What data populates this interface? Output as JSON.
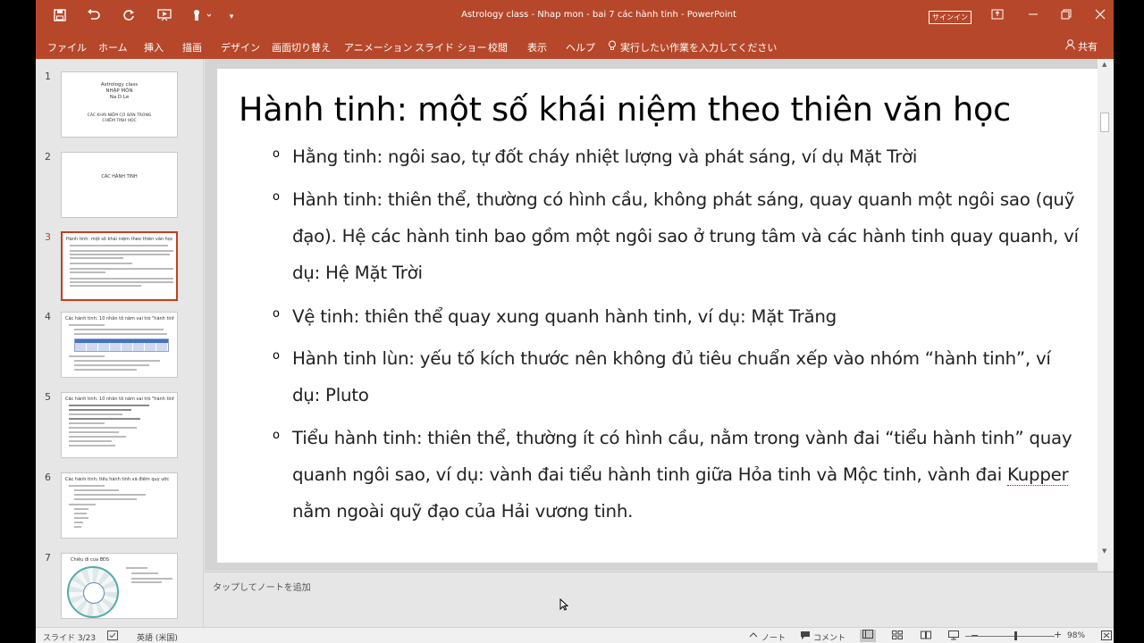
{
  "window": {
    "title": "Astrology class - Nhap mon - bai 7 các hành tinh  -  PowerPoint",
    "signin": "サインイン"
  },
  "quick_access": {
    "save_icon": "save-icon",
    "undo_icon": "undo-icon",
    "redo_icon": "redo-icon"
  },
  "ribbon": {
    "tabs": [
      "ファイル",
      "ホーム",
      "挿入",
      "描画",
      "デザイン",
      "画面切り替え",
      "アニメーション",
      "スライド ショー",
      "校閲",
      "表示",
      "ヘルプ"
    ],
    "tell_me": "実行したい作業を入力してください",
    "share": "共有"
  },
  "thumbnails": {
    "numbers": [
      "1",
      "2",
      "3",
      "4",
      "5",
      "6",
      "7"
    ],
    "slide1": {
      "line1": "Astrology class",
      "line2": "NHẬP MÔN",
      "line3": "Na D Le",
      "line4": "CÁC KHÁI NIỆM CƠ BẢN TRONG",
      "line5": "CHIÊM TINH HỌC"
    },
    "slide2": {
      "title": "CÁC HÀNH TINH"
    },
    "slide3": {
      "title": "Hành tinh: một số khái niệm theo thiên văn học"
    },
    "slide4": {
      "title": "Các hành tinh: 10 nhân tố nằm vai trò \"hành tinh\""
    },
    "slide5": {
      "title": "Các hành tinh: 10 nhân tố nằm vai trò \"hành tinh\""
    },
    "slide6": {
      "title": "Các hành tinh: tiểu hành tinh và điểm quy ước"
    },
    "slide7": {
      "title": "Chiều đi của BĐS"
    }
  },
  "slide": {
    "title": "Hành tinh: một số khái niệm theo thiên văn học",
    "bullet_glyph": "o",
    "bullets": [
      "Hằng tinh: ngôi sao, tự đốt cháy nhiệt lượng và phát sáng, ví dụ Mặt Trời",
      "Hành tinh: thiên thể, thường có hình cầu, không phát sáng, quay quanh một ngôi sao (quỹ đạo). Hệ các hành tinh bao gồm một ngôi sao ở trung tâm và các hành tinh quay quanh, ví dụ: Hệ Mặt Trời",
      "Vệ tinh: thiên thể quay xung quanh hành tinh, ví dụ: Mặt Trăng",
      "Hành tinh lùn: yếu tố kích thước nên không đủ tiêu chuẩn xếp vào nhóm “hành tinh”, ví dụ: Pluto",
      "Tiểu hành tinh: thiên thể, thường ít có hình cầu, nằm trong vành đai “tiểu hành tinh” quay quanh ngôi sao, ví dụ: vành đai tiểu hành tinh giữa Hỏa tinh và Mộc tinh, vành đai "
    ],
    "bullet5_spell": "Kupper",
    "bullet5_tail": " nằm ngoài quỹ đạo của Hải vương tinh."
  },
  "notes": {
    "placeholder": "タップしてノートを追加"
  },
  "status": {
    "slide_pos": "スライド 3/23",
    "language": "英語 (米国)",
    "notes_btn": "ノート",
    "comments_btn": "コメント",
    "zoom": "98%"
  },
  "colors": {
    "accent": "#b7472a",
    "active_thumb": "#c43e1c"
  }
}
